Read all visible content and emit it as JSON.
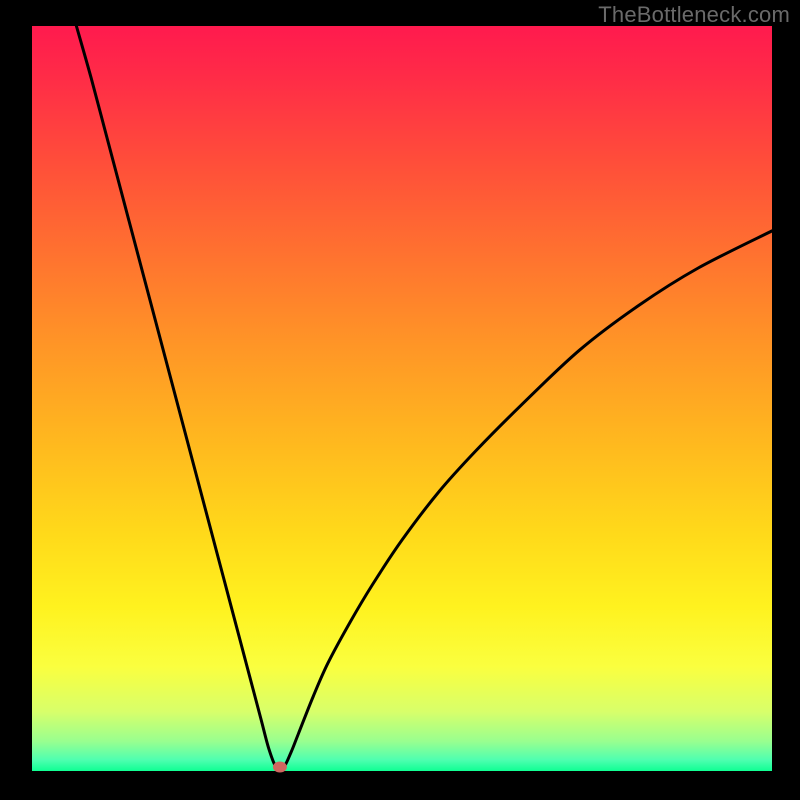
{
  "watermark": "TheBottleneck.com",
  "colors": {
    "background": "#000000",
    "curve": "#000000",
    "marker": "#d06760"
  },
  "plot": {
    "inner_x": 32,
    "inner_y": 26,
    "inner_w": 740,
    "inner_h": 745,
    "gradient_stops": [
      {
        "offset": 0.0,
        "color": "#ff1a4e"
      },
      {
        "offset": 0.07,
        "color": "#ff2c47"
      },
      {
        "offset": 0.18,
        "color": "#ff4d3a"
      },
      {
        "offset": 0.3,
        "color": "#ff7030"
      },
      {
        "offset": 0.42,
        "color": "#ff9327"
      },
      {
        "offset": 0.55,
        "color": "#ffb61f"
      },
      {
        "offset": 0.68,
        "color": "#ffd91a"
      },
      {
        "offset": 0.78,
        "color": "#fff21f"
      },
      {
        "offset": 0.86,
        "color": "#faff3f"
      },
      {
        "offset": 0.92,
        "color": "#d8ff6a"
      },
      {
        "offset": 0.96,
        "color": "#99ff8f"
      },
      {
        "offset": 0.985,
        "color": "#4fffb0"
      },
      {
        "offset": 1.0,
        "color": "#0fff93"
      }
    ]
  },
  "chart_data": {
    "type": "line",
    "title": "",
    "xlabel": "",
    "ylabel": "",
    "xlim": [
      0,
      100
    ],
    "ylim": [
      0,
      100
    ],
    "grid": false,
    "series": [
      {
        "name": "bottleneck-curve",
        "x": [
          6,
          8,
          10,
          12,
          14,
          16,
          18,
          20,
          22,
          24,
          26,
          28,
          29,
          30,
          31,
          32,
          33,
          34,
          35,
          36,
          38,
          40,
          43,
          46,
          50,
          55,
          60,
          66,
          74,
          82,
          90,
          100
        ],
        "y": [
          100,
          93,
          85.5,
          78,
          70.5,
          63,
          55.5,
          48,
          40.5,
          33,
          25.5,
          18,
          14.25,
          10.5,
          6.75,
          3,
          0.5,
          0.5,
          2.5,
          5,
          10,
          14.5,
          20,
          25,
          31,
          37.5,
          43,
          49,
          56.5,
          62.5,
          67.5,
          72.5
        ]
      }
    ],
    "marker": {
      "x": 33.5,
      "y": 0,
      "color": "#d06760"
    }
  }
}
